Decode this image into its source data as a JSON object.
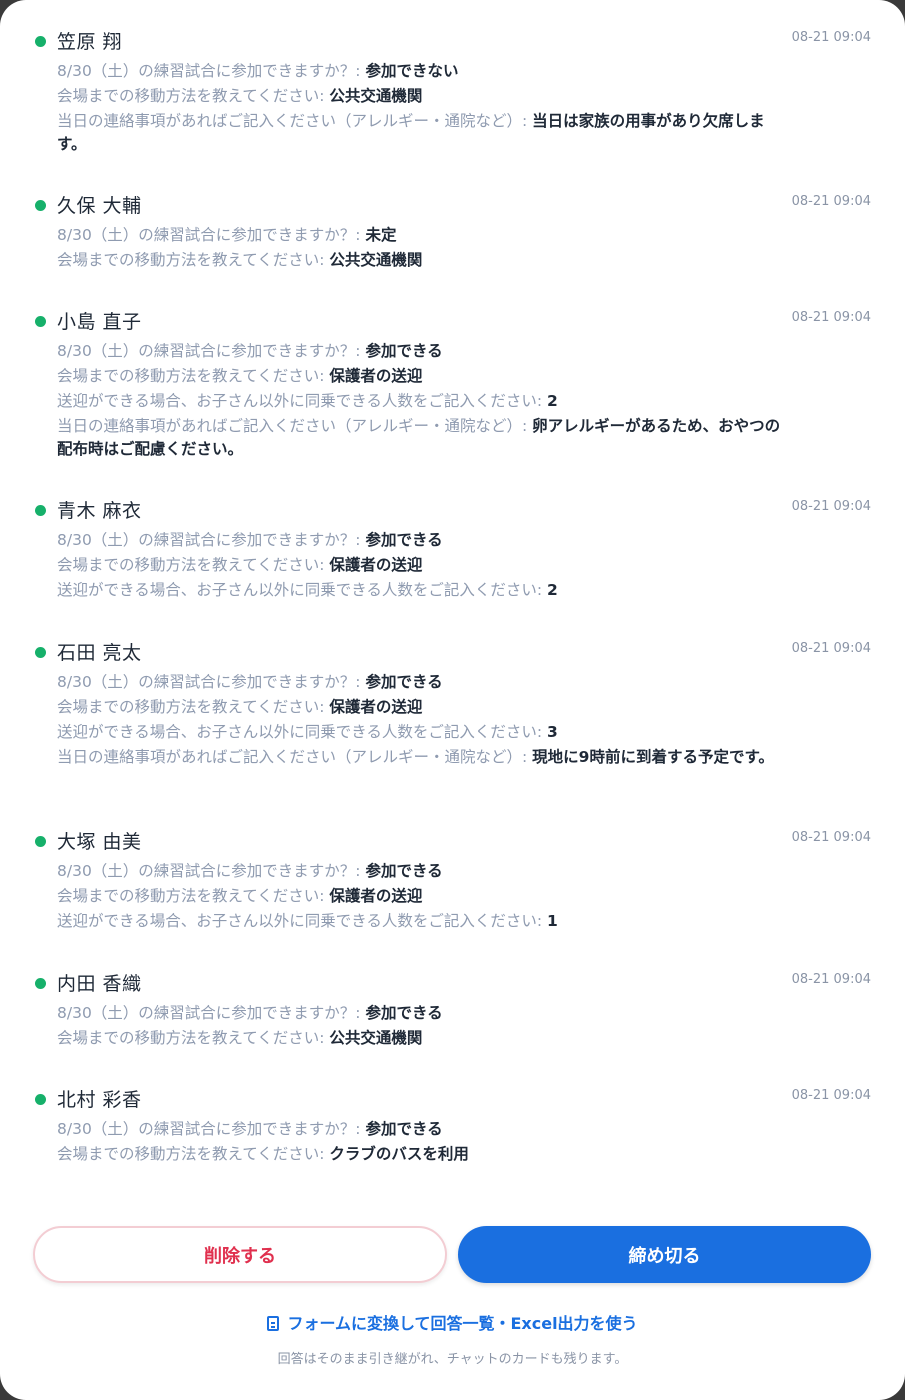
{
  "responses": [
    {
      "name": "笠原 翔",
      "time": "08-21 09:04",
      "answers": [
        {
          "q": "8/30（土）の練習試合に参加できますか？:",
          "a": "参加できない"
        },
        {
          "q": "会場までの移動方法を教えてください:",
          "a": "公共交通機関"
        },
        {
          "q": "当日の連絡事項があればご記入ください（アレルギー・通院など）:",
          "a": "当日は家族の用事があり欠席します。"
        }
      ]
    },
    {
      "name": "久保 大輔",
      "time": "08-21 09:04",
      "answers": [
        {
          "q": "8/30（土）の練習試合に参加できますか？:",
          "a": "未定"
        },
        {
          "q": "会場までの移動方法を教えてください:",
          "a": "公共交通機関"
        }
      ]
    },
    {
      "name": "小島 直子",
      "time": "08-21 09:04",
      "answers": [
        {
          "q": "8/30（土）の練習試合に参加できますか？:",
          "a": "参加できる"
        },
        {
          "q": "会場までの移動方法を教えてください:",
          "a": "保護者の送迎"
        },
        {
          "q": "送迎ができる場合、お子さん以外に同乗できる人数をご記入ください:",
          "a": "2"
        },
        {
          "q": "当日の連絡事項があればご記入ください（アレルギー・通院など）:",
          "a": "卵アレルギーがあるため、おやつの配布時はご配慮ください。"
        }
      ]
    },
    {
      "name": "青木 麻衣",
      "time": "08-21 09:04",
      "answers": [
        {
          "q": "8/30（土）の練習試合に参加できますか？:",
          "a": "参加できる"
        },
        {
          "q": "会場までの移動方法を教えてください:",
          "a": "保護者の送迎"
        },
        {
          "q": "送迎ができる場合、お子さん以外に同乗できる人数をご記入ください:",
          "a": "2"
        }
      ]
    },
    {
      "name": "石田 亮太",
      "time": "08-21 09:04",
      "answers": [
        {
          "q": "8/30（土）の練習試合に参加できますか？:",
          "a": "参加できる"
        },
        {
          "q": "会場までの移動方法を教えてください:",
          "a": "保護者の送迎"
        },
        {
          "q": "送迎ができる場合、お子さん以外に同乗できる人数をご記入ください:",
          "a": "3"
        },
        {
          "q": "当日の連絡事項があればご記入ください（アレルギー・通院など）:",
          "a": "現地に9時前に到着する予定です。"
        }
      ]
    },
    {
      "name": "大塚 由美",
      "time": "08-21 09:04",
      "answers": [
        {
          "q": "8/30（土）の練習試合に参加できますか？:",
          "a": "参加できる"
        },
        {
          "q": "会場までの移動方法を教えてください:",
          "a": "保護者の送迎"
        },
        {
          "q": "送迎ができる場合、お子さん以外に同乗できる人数をご記入ください:",
          "a": "1"
        }
      ]
    },
    {
      "name": "内田 香織",
      "time": "08-21 09:04",
      "answers": [
        {
          "q": "8/30（土）の練習試合に参加できますか？:",
          "a": "参加できる"
        },
        {
          "q": "会場までの移動方法を教えてください:",
          "a": "公共交通機関"
        }
      ]
    },
    {
      "name": "北村 彩香",
      "time": "08-21 09:04",
      "answers": [
        {
          "q": "8/30（土）の練習試合に参加できますか？:",
          "a": "参加できる"
        },
        {
          "q": "会場までの移動方法を教えてください:",
          "a": "クラブのバスを利用"
        }
      ]
    }
  ],
  "actions": {
    "delete_label": "削除する",
    "close_label": "締め切る"
  },
  "footer": {
    "convert_link": "フォームに変換して回答一覧・Excel出力を使う",
    "note": "回答はそのまま引き継がれ、チャットのカードも残ります。"
  },
  "colors": {
    "status_dot": "#16b06a",
    "primary": "#1a6fe0",
    "danger": "#e0304e"
  },
  "icons": {
    "status": "status-dot-icon",
    "convert": "document-icon"
  }
}
